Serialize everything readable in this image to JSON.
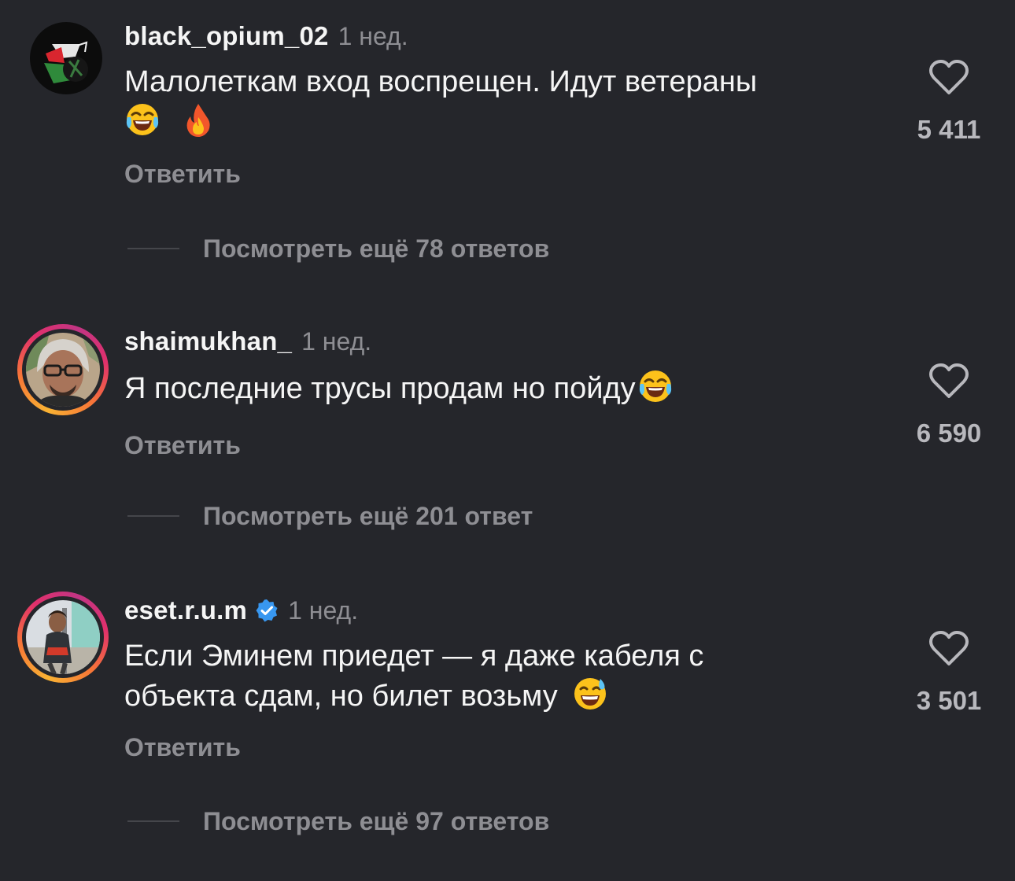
{
  "comments": [
    {
      "username": "black_opium_02",
      "time": "1 нед.",
      "text": "Малолеткам вход воспрещен. Идут ветераны",
      "emojis": [
        "face-with-tears-of-joy-emoji",
        "fire-emoji"
      ],
      "reply_label": "Ответить",
      "view_replies": "Посмотреть ещё 78 ответов",
      "likes": "5 411",
      "verified": false,
      "story_ring": false
    },
    {
      "username": "shaimukhan_",
      "time": "1 нед.",
      "text": "Я последние трусы продам но пойду",
      "emojis": [
        "face-with-tears-of-joy-emoji"
      ],
      "reply_label": "Ответить",
      "view_replies": "Посмотреть ещё 201 ответ",
      "likes": "6 590",
      "verified": false,
      "story_ring": true
    },
    {
      "username": "eset.r.u.m",
      "time": "1 нед.",
      "text_line1": "Если Эминем приедет — я даже кабеля с",
      "text_line2": "объекта сдам, но билет возьму",
      "emojis": [
        "grinning-face-with-sweat-emoji"
      ],
      "reply_label": "Ответить",
      "view_replies": "Посмотреть ещё 97 ответов",
      "likes": "3 501",
      "verified": true,
      "story_ring": true
    }
  ],
  "colors": {
    "background": "#25262b",
    "text_primary": "#f5f5f5",
    "text_secondary": "#8e8e93",
    "verified_blue": "#3897f0",
    "story_ring": [
      "#f9b233",
      "#f77737",
      "#e1306c",
      "#c13584"
    ]
  }
}
